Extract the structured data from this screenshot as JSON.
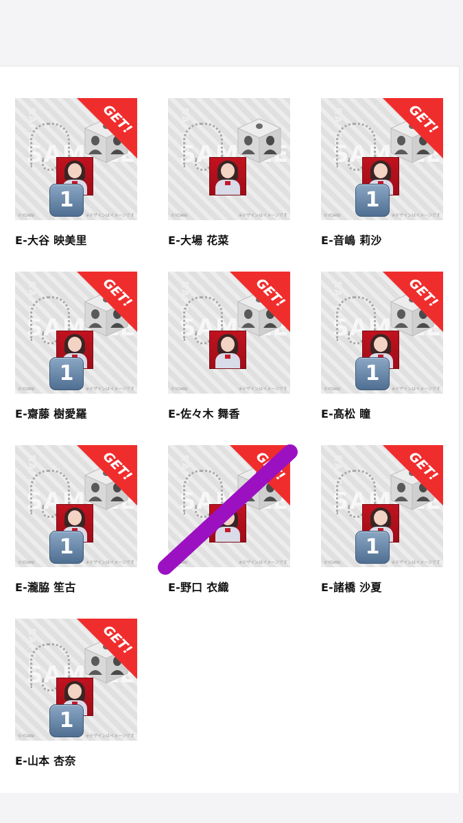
{
  "colors": {
    "ribbon": "#f02d2d",
    "badge": "#5d7fa3",
    "scribble": "#9b11c1",
    "background": "#f4f4f6"
  },
  "grid": {
    "items": [
      {
        "name": "E-大谷 映美里",
        "get": true,
        "count": "1",
        "cube_icon": "cube-silhouette-icon"
      },
      {
        "name": "E-大場 花菜",
        "get": false,
        "count": null,
        "cube_icon": "cube-silhouette-icon"
      },
      {
        "name": "E-音嶋 莉沙",
        "get": true,
        "count": "1",
        "cube_icon": "cube-silhouette-icon"
      },
      {
        "name": "E-齋藤 樹愛羅",
        "get": true,
        "count": "1",
        "cube_icon": "cube-silhouette-icon"
      },
      {
        "name": "E-佐々木 舞香",
        "get": true,
        "count": null,
        "cube_icon": "cube-silhouette-icon"
      },
      {
        "name": "E-髙松 瞳",
        "get": true,
        "count": "1",
        "cube_icon": "cube-silhouette-icon"
      },
      {
        "name": "E-瀧脇 笙古",
        "get": true,
        "count": "1",
        "cube_icon": "cube-silhouette-icon"
      },
      {
        "name": "E-野口 衣織",
        "get": true,
        "count": null,
        "cube_icon": "cube-silhouette-icon",
        "crossed_out": true
      },
      {
        "name": "E-諸橋 沙夏",
        "get": true,
        "count": "1",
        "cube_icon": "cube-silhouette-icon"
      },
      {
        "name": "E-山本 杏奈",
        "get": true,
        "count": "1",
        "cube_icon": "cube-silhouette-icon"
      }
    ],
    "ribbon_text": "GET!",
    "watermark_sample": "SAMPLE",
    "watermark_raffle": "RAFFLE",
    "footer_left": "©YOANI",
    "footer_right": "※デザインはイメージです"
  }
}
